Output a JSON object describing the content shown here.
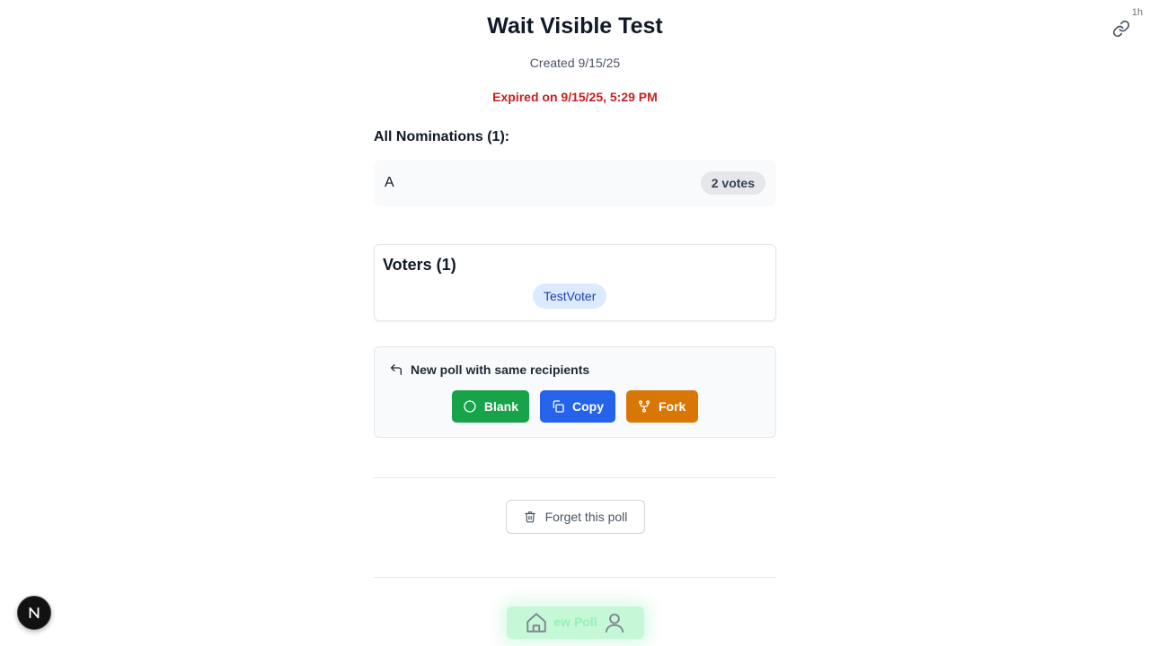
{
  "header": {
    "title": "Wait Visible Test",
    "created": "Created 9/15/25",
    "expired": "Expired on 9/15/25, 5:29 PM",
    "relative_time": "1h"
  },
  "nominations": {
    "heading": "All Nominations (1):",
    "items": [
      {
        "name": "A",
        "votes_label": "2 votes"
      }
    ]
  },
  "voters": {
    "title": "Voters (1)",
    "names": [
      "TestVoter"
    ]
  },
  "new_poll": {
    "heading": "New poll with same recipients",
    "buttons": {
      "blank": "Blank",
      "copy": "Copy",
      "fork": "Fork"
    }
  },
  "forget": {
    "label": "Forget this poll"
  },
  "bottom_nav": {
    "label": "ew Poll"
  },
  "icons": {
    "link": "link-icon",
    "reply": "reply-icon",
    "circle": "circle-icon",
    "copy": "copy-icon",
    "fork": "fork-icon",
    "trash": "trash-icon",
    "home": "home-icon",
    "user": "user-icon",
    "next": "next-logo-icon"
  },
  "colors": {
    "expired": "#c81e1e",
    "blank": "#16a34a",
    "copy": "#2563eb",
    "fork": "#d97706",
    "voter_chip": "#dbeafe"
  }
}
